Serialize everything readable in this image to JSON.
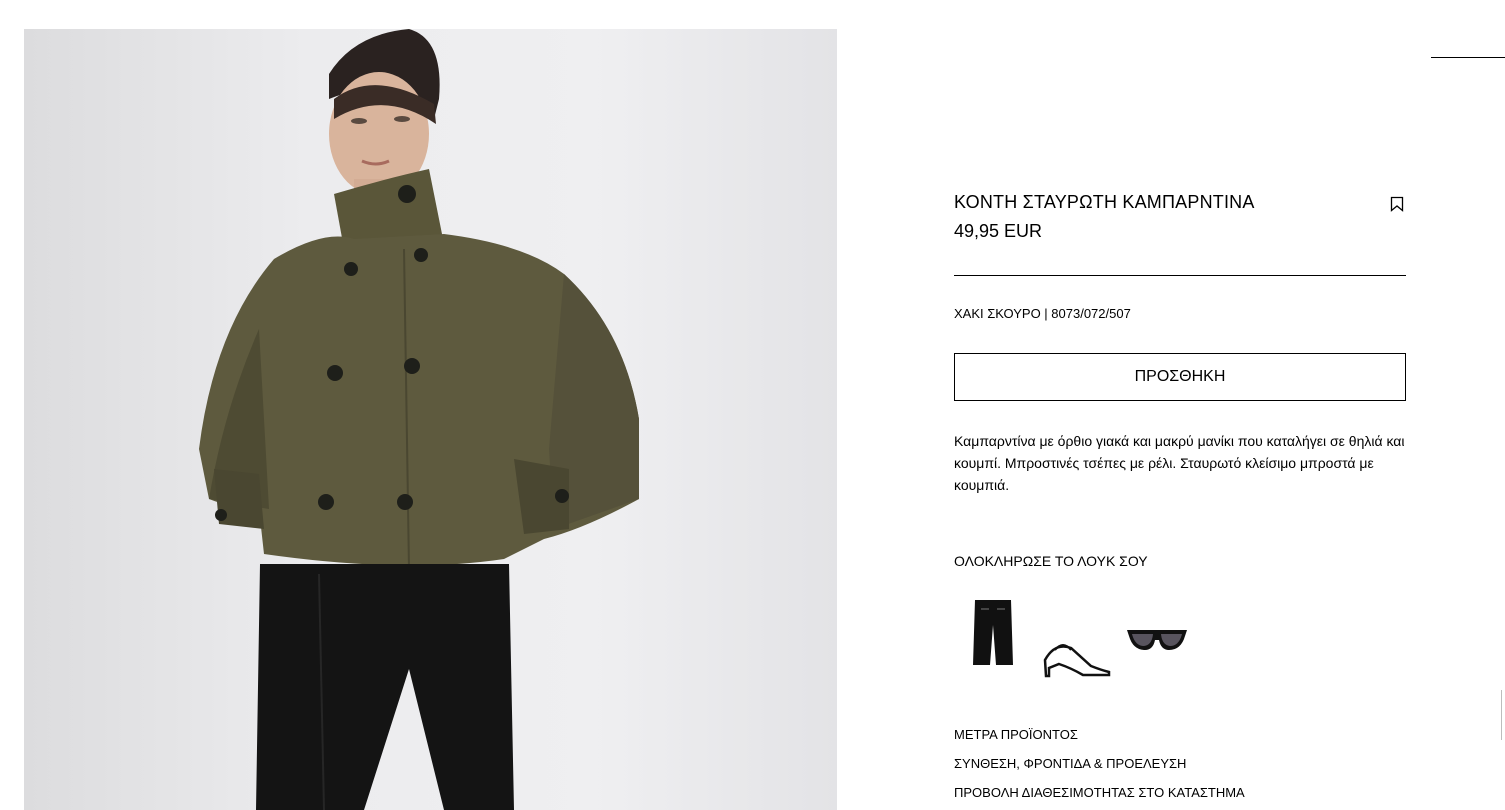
{
  "product": {
    "title": "ΚΟΝΤΗ ΣΤΑΥΡΩΤΗ ΚΑΜΠΑΡΝΤΙΝΑ",
    "price": "49,95 EUR",
    "color_ref": "ΧΑΚΙ ΣΚΟΥΡΟ | 8073/072/507",
    "add_label": "ΠΡΟΣΘΗΚΗ",
    "description": "Καμπαρντίνα με όρθιο γιακά και μακρύ μανίκι που καταλήγει σε θηλιά και κουμπί. Μπροστινές τσέπες με ρέλι. Σταυρωτό κλείσιμο μπροστά με κουμπιά."
  },
  "look": {
    "title": "ΟΛΟΚΛΗΡΩΣΕ ΤΟ ΛΟΥΚ ΣΟΥ",
    "items": [
      "black-trousers",
      "black-sandals",
      "black-sunglasses"
    ]
  },
  "links": {
    "measurements": "ΜΕΤΡΑ ΠΡΟΪΟΝΤΟΣ",
    "composition": "ΣΥΝΘΕΣΗ, ΦΡΟΝΤΙΔΑ & ΠΡΟΕΛΕΥΣΗ",
    "availability": "ΠΡΟΒΟΛΗ ΔΙΑΘΕΣΙΜΟΤΗΤΑΣ ΣΤΟ ΚΑΤΑΣΤΗΜΑ"
  },
  "colors": {
    "jacket": "#5e5a3e",
    "background": "#ececee",
    "text": "#000000"
  },
  "icons": {
    "bookmark": "bookmark-icon"
  }
}
